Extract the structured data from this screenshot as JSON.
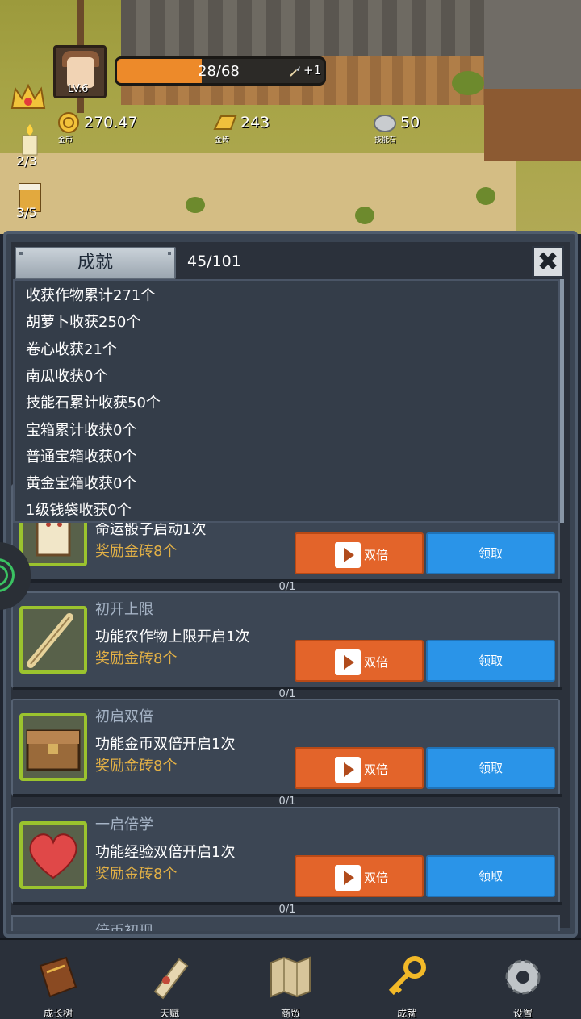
{
  "hud": {
    "level": "LV.6",
    "xp_text": "28/68",
    "xp_fraction": 0.41,
    "xp_bonus": "+1",
    "resources": [
      {
        "icon": "gold-coin-icon",
        "value": "270.47",
        "caption": "金币"
      },
      {
        "icon": "gold-brick-icon",
        "value": "243",
        "caption": "金砖"
      },
      {
        "icon": "skill-stone-icon",
        "value": "50",
        "caption": "技能石"
      }
    ],
    "side": [
      {
        "icon": "candle-icon",
        "count": "2/3"
      },
      {
        "icon": "drink-cup-icon",
        "count": "3/5"
      }
    ]
  },
  "panel": {
    "title": "成就",
    "count": "45/101",
    "close": "✖",
    "stats": [
      "收获作物累计271个",
      "胡萝卜收获250个",
      "卷心收获21个",
      "南瓜收获0个",
      "技能石累计收获50个",
      "宝箱累计收获0个",
      "普通宝箱收获0个",
      "黄金宝箱收获0个",
      "1级钱袋收获0个"
    ],
    "cards": [
      {
        "name": "",
        "desc": "命运骰子启动1次",
        "reward": "奖励金砖8个",
        "double": "双倍",
        "claim": "领取",
        "progress": "0/1",
        "icon": "dice-icon"
      },
      {
        "name": "初开上限",
        "desc": "功能农作物上限开启1次",
        "reward": "奖励金砖8个",
        "double": "双倍",
        "claim": "领取",
        "progress": "0/1",
        "icon": "wand-icon"
      },
      {
        "name": "初启双倍",
        "desc": "功能金币双倍开启1次",
        "reward": "奖励金砖8个",
        "double": "双倍",
        "claim": "领取",
        "progress": "0/1",
        "icon": "treasure-chest-icon"
      },
      {
        "name": "一启倍学",
        "desc": "功能经验双倍开启1次",
        "reward": "奖励金砖8个",
        "double": "双倍",
        "claim": "领取",
        "progress": "0/1",
        "icon": "heart-icon"
      }
    ],
    "partial_name": "倍币初现"
  },
  "nav": [
    {
      "label": "成长树",
      "icon": "book-icon"
    },
    {
      "label": "天赋",
      "icon": "scroll-icon"
    },
    {
      "label": "商贸",
      "icon": "map-icon"
    },
    {
      "label": "成就",
      "icon": "key-icon"
    },
    {
      "label": "设置",
      "icon": "gear-icon"
    }
  ]
}
